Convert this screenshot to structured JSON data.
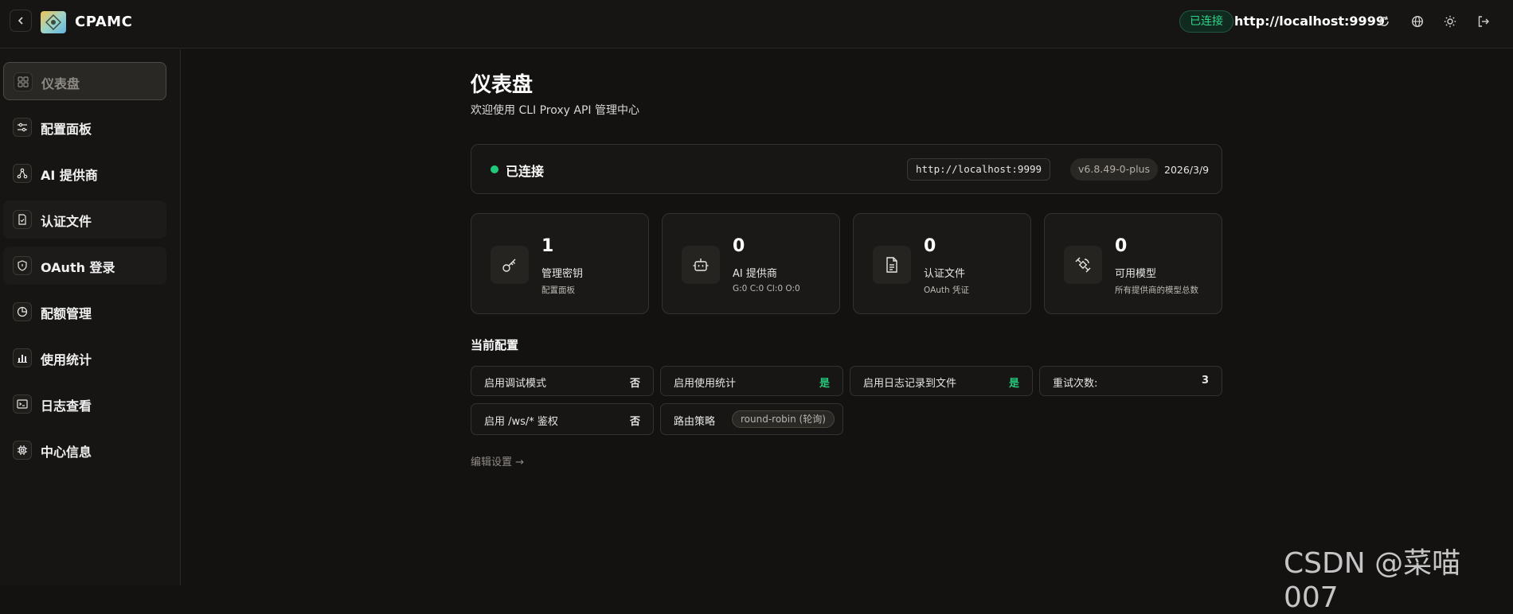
{
  "header": {
    "brand": "CPAMC",
    "connection_badge": "已连接",
    "url": "http://localhost:9999",
    "icons": [
      "back-icon",
      "logo",
      "refresh-icon",
      "globe-icon",
      "sun-icon",
      "logout-icon"
    ]
  },
  "sidebar": {
    "items": [
      {
        "label": "仪表盘",
        "icon": "dashboard-icon",
        "active": true
      },
      {
        "label": "配置面板",
        "icon": "sliders-icon"
      },
      {
        "label": "AI 提供商",
        "icon": "network-icon"
      },
      {
        "label": "认证文件",
        "icon": "file-check-icon"
      },
      {
        "label": "OAuth 登录",
        "icon": "shield-icon"
      },
      {
        "label": "配额管理",
        "icon": "pie-chart-icon"
      },
      {
        "label": "使用统计",
        "icon": "bar-chart-icon"
      },
      {
        "label": "日志查看",
        "icon": "terminal-icon"
      },
      {
        "label": "中心信息",
        "icon": "chip-icon"
      }
    ]
  },
  "main": {
    "title": "仪表盘",
    "subtitle": "欢迎使用 CLI Proxy API 管理中心",
    "status": {
      "text": "已连接",
      "url": "http://localhost:9999",
      "version": "v6.8.49-0-plus",
      "date": "2026/3/9",
      "status_color": "#1fc97a"
    },
    "stats": [
      {
        "value": "1",
        "label": "管理密钥",
        "sub": "配置面板",
        "icon": "key-icon"
      },
      {
        "value": "0",
        "label": "AI 提供商",
        "sub": "G:0 C:0 Cl:0 O:0",
        "icon": "bot-icon"
      },
      {
        "value": "0",
        "label": "认证文件",
        "sub": "OAuth 凭证",
        "icon": "document-icon"
      },
      {
        "value": "0",
        "label": "可用模型",
        "sub": "所有提供商的模型总数",
        "icon": "satellite-icon"
      }
    ],
    "config_title": "当前配置",
    "config": [
      {
        "label": "启用调试模式",
        "value": "否"
      },
      {
        "label": "启用使用统计",
        "value": "是"
      },
      {
        "label": "启用日志记录到文件",
        "value": "是"
      },
      {
        "label": "重试次数:",
        "value": "3"
      },
      {
        "label": "启用 /ws/* 鉴权",
        "value": "否"
      },
      {
        "label": "路由策略",
        "chip": "round-robin (轮询)"
      }
    ],
    "edit_link": "编辑设置 →"
  },
  "watermark": "CSDN @菜喵007",
  "colors": {
    "accent_green": "#1fc97a",
    "background": "#131211",
    "border": "#34322e"
  }
}
